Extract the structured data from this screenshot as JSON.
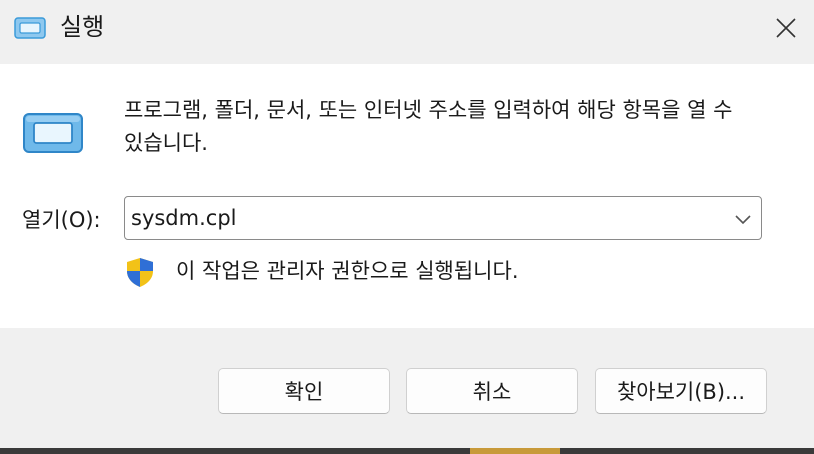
{
  "window": {
    "title": "실행",
    "close_glyph": "✕"
  },
  "content": {
    "description": "프로그램, 폴더, 문서, 또는 인터넷 주소를 입력하여 해당 항목을 열 수 있습니다.",
    "open_label": "열기(O):",
    "open_value": "sysdm.cpl",
    "admin_note": "이 작업은 관리자 권한으로 실행됩니다."
  },
  "buttons": {
    "ok": "확인",
    "cancel": "취소",
    "browse": "찾아보기(B)..."
  },
  "icons": {
    "title": "run-dialog-icon",
    "main": "run-dialog-icon",
    "shield": "uac-shield-icon",
    "chevron": "chevron-down-icon",
    "close": "close-icon"
  },
  "colors": {
    "window_bg": "#f0f0f0",
    "panel_bg": "#ffffff",
    "run_icon_blue": "#3a9ad9",
    "shield_blue": "#2f6fd6",
    "shield_yellow": "#f2c218"
  }
}
